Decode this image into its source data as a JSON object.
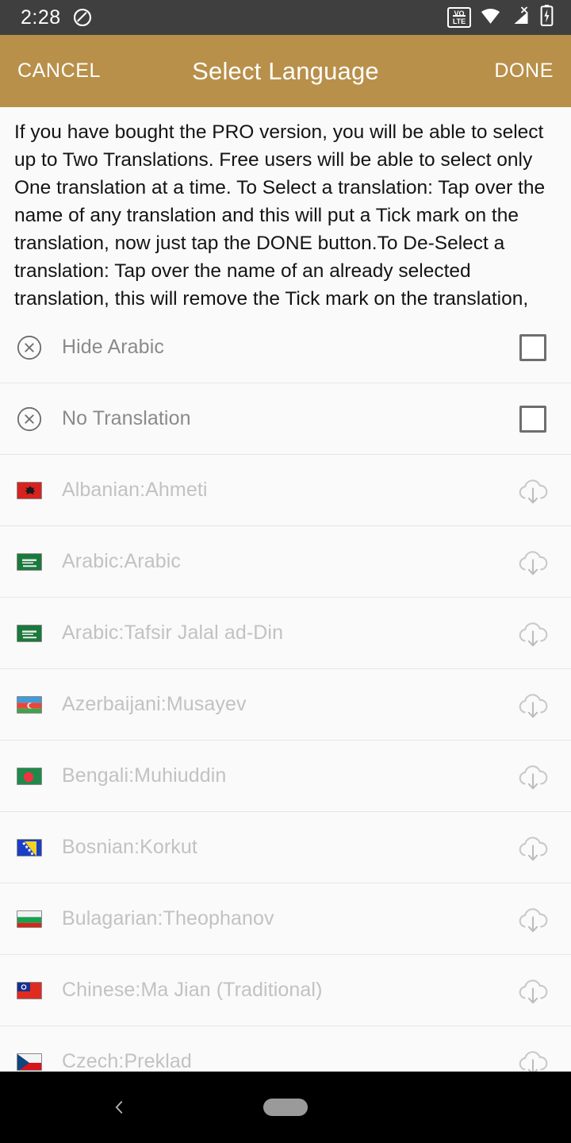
{
  "status_bar": {
    "time": "2:28",
    "left_icons": [
      "do-not-disturb-icon"
    ],
    "right_icons": [
      "volte-icon",
      "wifi-icon",
      "cellular-signal-no-service-icon",
      "battery-charging-icon"
    ],
    "volte_top": "VO",
    "volte_bottom": "LTE",
    "background_color": "#3f3f3f"
  },
  "action_bar": {
    "cancel_label": "CANCEL",
    "title": "Select Language",
    "done_label": "DONE",
    "background_color": "#b8904a",
    "text_color": "#ffffff"
  },
  "description": {
    "text": "If you have bought the PRO version, you will be able to select up to Two Translations. Free users will be able to select only One translation at a time. To Select a translation: Tap over the name of any translation and this will put a Tick mark on the translation, now just tap the DONE button.To De-Select a translation: Tap over the name of an already selected translation, this will remove the Tick mark on the translation, now just tap the DONE button."
  },
  "list": {
    "rows": [
      {
        "label": "Hide Arabic",
        "kind": "special",
        "lead_icon": "circle-x-icon",
        "trail_icon": "checkbox-unchecked-icon",
        "checked": false
      },
      {
        "label": "No Translation",
        "kind": "special",
        "lead_icon": "circle-x-icon",
        "trail_icon": "checkbox-unchecked-icon",
        "checked": false
      },
      {
        "label": "Albanian:Ahmeti",
        "kind": "lang",
        "lead_icon": "flag-albania-icon",
        "trail_icon": "cloud-download-icon"
      },
      {
        "label": "Arabic:Arabic",
        "kind": "lang",
        "lead_icon": "flag-saudi-arabia-icon",
        "trail_icon": "cloud-download-icon"
      },
      {
        "label": "Arabic:Tafsir Jalal ad-Din",
        "kind": "lang",
        "lead_icon": "flag-saudi-arabia-icon",
        "trail_icon": "cloud-download-icon"
      },
      {
        "label": "Azerbaijani:Musayev",
        "kind": "lang",
        "lead_icon": "flag-azerbaijan-icon",
        "trail_icon": "cloud-download-icon"
      },
      {
        "label": "Bengali:Muhiuddin",
        "kind": "lang",
        "lead_icon": "flag-bangladesh-icon",
        "trail_icon": "cloud-download-icon"
      },
      {
        "label": "Bosnian:Korkut",
        "kind": "lang",
        "lead_icon": "flag-bosnia-icon",
        "trail_icon": "cloud-download-icon"
      },
      {
        "label": "Bulagarian:Theophanov",
        "kind": "lang",
        "lead_icon": "flag-bulgaria-icon",
        "trail_icon": "cloud-download-icon"
      },
      {
        "label": "Chinese:Ma Jian (Traditional)",
        "kind": "lang",
        "lead_icon": "flag-taiwan-icon",
        "trail_icon": "cloud-download-icon"
      },
      {
        "label": "Czech:Preklad",
        "kind": "lang",
        "lead_icon": "flag-czech-icon",
        "trail_icon": "cloud-download-icon"
      }
    ],
    "special_text_color": "#8a8a8a",
    "lang_text_color": "#c2c2c2",
    "divider_color": "#e6e6e6",
    "background_color": "#fafafa"
  },
  "nav_bar": {
    "back_icon": "chevron-left-icon",
    "home_pill_icon": "home-pill-icon",
    "background_color": "#000000"
  }
}
